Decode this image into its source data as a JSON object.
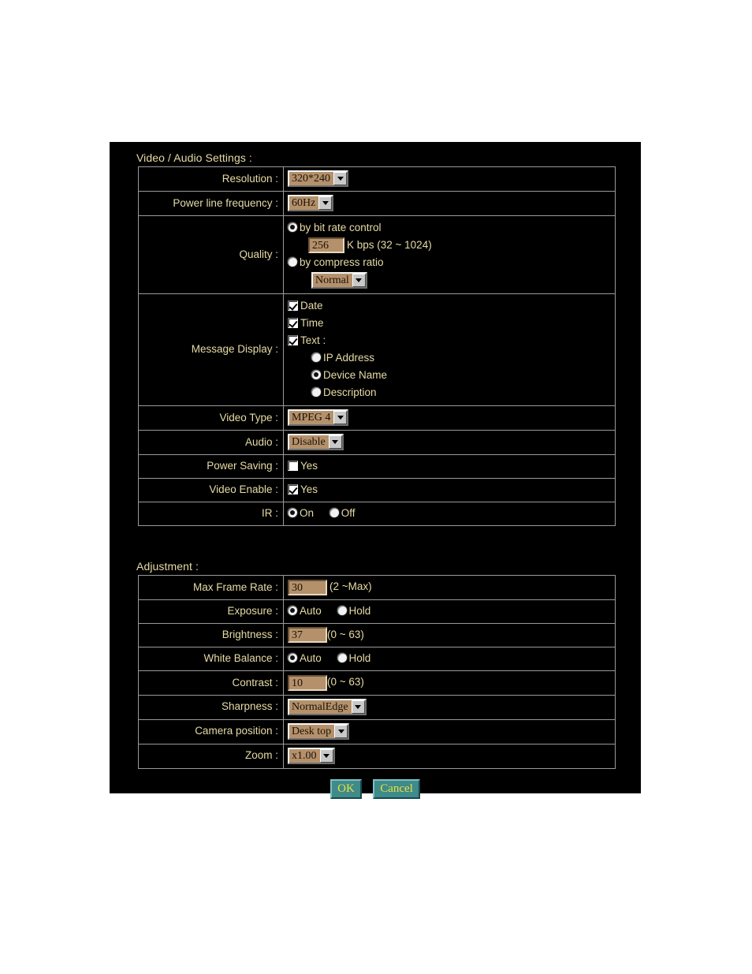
{
  "video_audio": {
    "section_title": "Video / Audio Settings :",
    "rows": {
      "resolution": {
        "label": "Resolution :",
        "value": "320*240"
      },
      "power_line_frequency": {
        "label": "Power line frequency :",
        "value": "60Hz"
      },
      "quality": {
        "label": "Quality :",
        "bitrate_option": "by bit rate control",
        "bitrate_value": "256",
        "bitrate_hint": "K bps (32 ~ 1024)",
        "compress_option": "by compress ratio",
        "compress_value": "Normal",
        "selected": "bitrate"
      },
      "message_display": {
        "label": "Message Display :",
        "date_label": "Date",
        "date_checked": true,
        "time_label": "Time",
        "time_checked": true,
        "text_label": "Text :",
        "text_checked": true,
        "text_options": [
          "IP Address",
          "Device Name",
          "Description"
        ],
        "text_selected": "Device Name"
      },
      "video_type": {
        "label": "Video Type :",
        "value": "MPEG 4"
      },
      "audio": {
        "label": "Audio :",
        "value": "Disable"
      },
      "power_saving": {
        "label": "Power Saving :",
        "option": "Yes",
        "checked": false
      },
      "video_enable": {
        "label": "Video Enable :",
        "option": "Yes",
        "checked": true
      },
      "ir": {
        "label": "IR :",
        "on_label": "On",
        "off_label": "Off",
        "selected": "On"
      }
    }
  },
  "adjustment": {
    "section_title": "Adjustment :",
    "rows": {
      "max_frame_rate": {
        "label": "Max Frame Rate :",
        "value": "30",
        "hint": "(2 ~Max)"
      },
      "exposure": {
        "label": "Exposure :",
        "auto_label": "Auto",
        "hold_label": "Hold",
        "selected": "Auto"
      },
      "brightness": {
        "label": "Brightness :",
        "value": "37",
        "hint": "(0 ~ 63)"
      },
      "white_balance": {
        "label": "White Balance :",
        "auto_label": "Auto",
        "hold_label": "Hold",
        "selected": "Auto"
      },
      "contrast": {
        "label": "Contrast :",
        "value": "10",
        "hint": "(0 ~ 63)"
      },
      "sharpness": {
        "label": "Sharpness :",
        "value": "NormalEdge"
      },
      "camera_position": {
        "label": "Camera position :",
        "value": "Desk top"
      },
      "zoom": {
        "label": "Zoom :",
        "value": "x1.00"
      }
    }
  },
  "buttons": {
    "ok": "OK",
    "cancel": "Cancel"
  },
  "colors": {
    "panel_bg": "#000000",
    "label_text": "#e6dba6",
    "field_bg": "#b5916b",
    "button_bg": "#3f8a8a",
    "button_text": "#e8e23c",
    "border": "#9a9a9a"
  }
}
